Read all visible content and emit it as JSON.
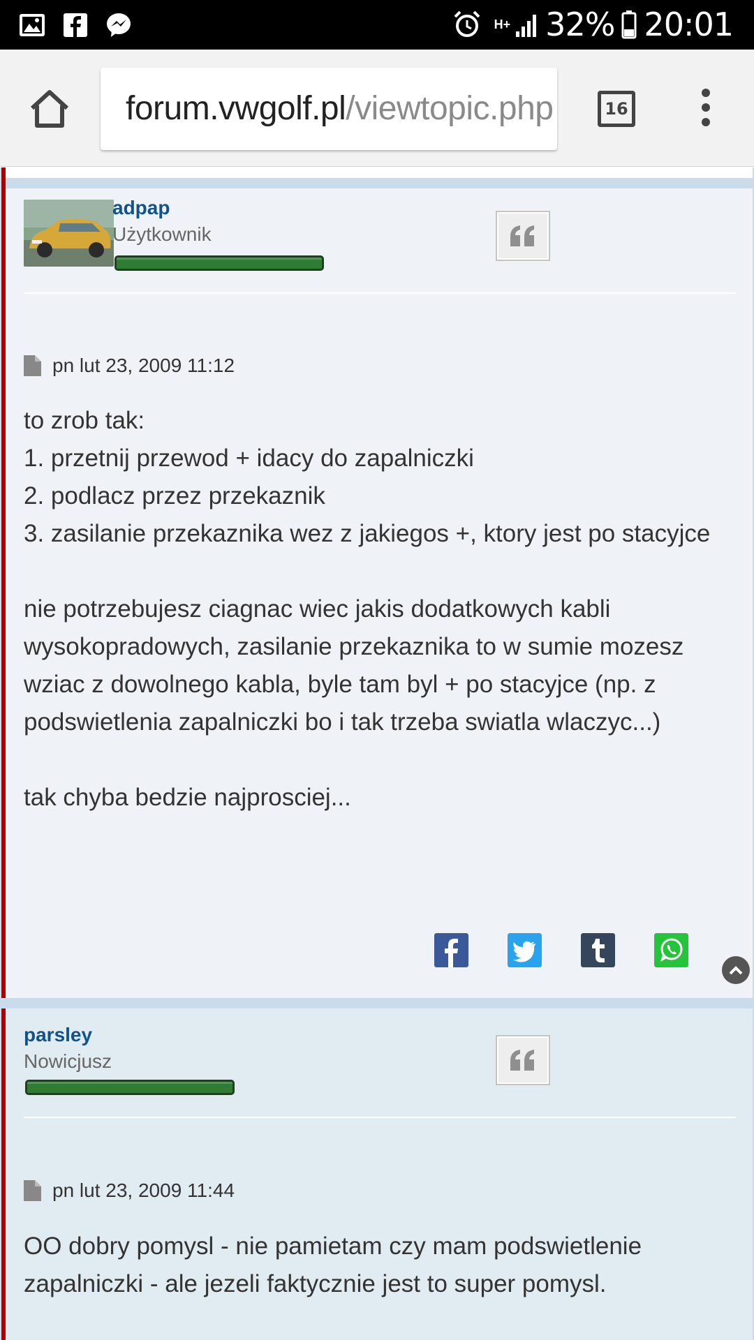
{
  "status_bar": {
    "battery": "32%",
    "time": "20:01",
    "network": "H+"
  },
  "browser": {
    "url_domain": "forum.vwgolf.pl",
    "url_path": "/viewtopic.php",
    "tab_count": "16"
  },
  "posts": [
    {
      "username": "adpap",
      "rank": "Użytkownik",
      "date": "pn lut 23, 2009 11:12",
      "body": [
        "to zrob tak:",
        "1. przetnij przewod + idacy do zapalniczki",
        "2. podlacz przez przekaznik",
        "3. zasilanie przekaznika wez z jakiegos +, ktory jest po stacyjce",
        "",
        "nie potrzebujesz ciagnac wiec jakis dodatkowych kabli wysokopradowych, zasilanie przekaznika to w sumie mozesz wziac z dowolnego kabla, byle tam byl + po stacyjce (np. z podswietlenia zapalniczki bo i tak trzeba swiatla wlaczyc...)",
        "",
        "tak chyba bedzie najprosciej..."
      ]
    },
    {
      "username": "parsley",
      "rank": "Nowicjusz",
      "date": "pn lut 23, 2009 11:44",
      "body": [
        "OO dobry pomysl - nie pamietam czy mam podswietlenie zapalniczki - ale jezeli faktycznie jest to super pomysl."
      ]
    }
  ],
  "share_icons": [
    "facebook-icon",
    "twitter-icon",
    "tumblr-icon",
    "whatsapp-icon"
  ],
  "colors": {
    "accent_red": "#aa0000",
    "username_blue": "#105289",
    "rank_bar_green": "#2e7d32",
    "post_bg_1": "#eff3f7",
    "post_bg_2": "#e1ebf2"
  }
}
